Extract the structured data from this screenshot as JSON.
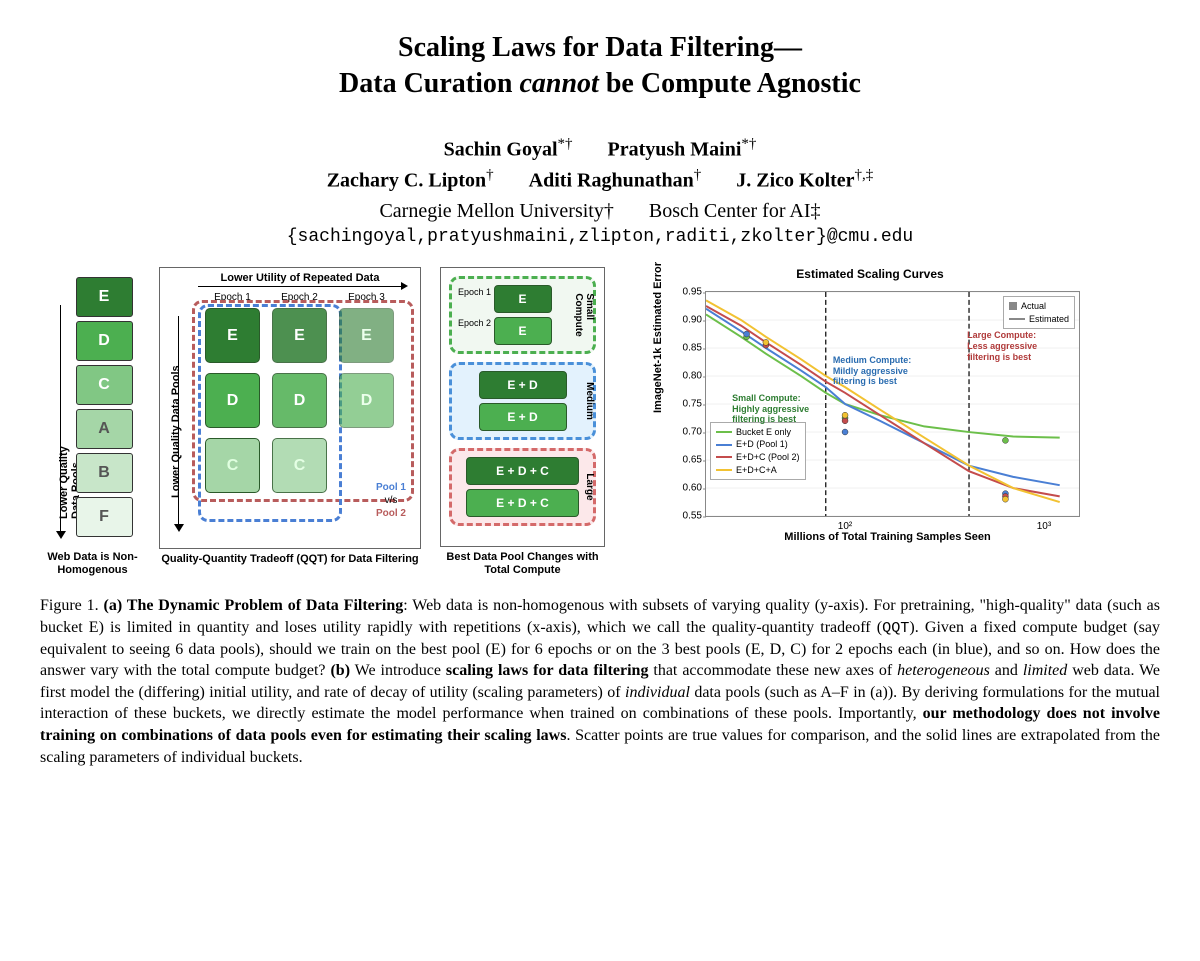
{
  "title_line1": "Scaling Laws for Data Filtering—",
  "title_line2_a": "Data Curation ",
  "title_line2_b": "cannot",
  "title_line2_c": " be Compute Agnostic",
  "authors": {
    "a1": "Sachin Goyal",
    "a1_sup": "*†",
    "a2": "Pratyush Maini",
    "a2_sup": "*†",
    "a3": "Zachary C. Lipton",
    "a3_sup": "†",
    "a4": "Aditi Raghunathan",
    "a4_sup": "†",
    "a5": "J. Zico Kolter",
    "a5_sup": "†,‡"
  },
  "affil1": "Carnegie Mellon University",
  "affil1_sup": "†",
  "affil2": "Bosch Center for AI",
  "affil2_sup": "‡",
  "emails": "{sachingoyal,pratyushmaini,zlipton,raditi,zkolter}@cmu.edu",
  "panel1": {
    "ylabel": "Lower Quality Data Pools",
    "buckets": [
      "E",
      "D",
      "C",
      "A",
      "B",
      "F"
    ],
    "colors": [
      "#2e7d32",
      "#4caf50",
      "#81c784",
      "#a5d6a7",
      "#c8e6c9",
      "#e8f5e9"
    ],
    "caption": "Web Data is Non-Homogenous"
  },
  "panel2": {
    "xlabel": "Lower Utility of Repeated Data",
    "ylabel": "Lower Quality Data Pools",
    "col_heads": [
      "Epoch 1",
      "Epoch 2",
      "Epoch 3"
    ],
    "grid": [
      [
        "E",
        "E",
        "E"
      ],
      [
        "D",
        "D",
        "D"
      ],
      [
        "C",
        "C",
        ""
      ]
    ],
    "colors_row": [
      "#2e7d32",
      "#4caf50",
      "#a5d6a7"
    ],
    "legend": {
      "pool1": "Pool 1",
      "vs": "v/s",
      "pool2": "Pool 2"
    },
    "caption": "Quality-Quantity Tradeoff (QQT) for Data Filtering"
  },
  "panel3": {
    "small": {
      "label": "Small Compute",
      "epochs": [
        "Epoch 1",
        "Epoch 2"
      ],
      "items": [
        "E",
        "E"
      ],
      "color": "#4caf50",
      "border": "#4caf50"
    },
    "medium": {
      "label": "Medium",
      "items": [
        "E + D",
        "E + D"
      ],
      "color": "#4a90d9",
      "border": "#4a90d9",
      "bg": "#e3f2fd"
    },
    "large": {
      "label": "Large",
      "items": [
        "E + D + C",
        "E + D + C"
      ],
      "color": "#d46a6a",
      "border": "#d46a6a",
      "bg": "#fce4ec"
    },
    "caption": "Best Data Pool Changes with Total Compute"
  },
  "panel4": {
    "title": "Estimated Scaling Curves",
    "xlabel": "Millions of Total Training Samples Seen",
    "ylabel": "ImageNet-1k Estimated Error",
    "legend1": {
      "actual": "Actual",
      "estimated": "Estimated"
    },
    "legend2": [
      "Bucket E only",
      "E+D (Pool 1)",
      "E+D+C (Pool 2)",
      "E+D+C+A"
    ],
    "legend2_colors": [
      "#6cbf4a",
      "#4a7fd4",
      "#c44c4c",
      "#f2c232"
    ],
    "annotations": {
      "small": "Small Compute:\nHighly aggressive\nfiltering is best",
      "medium": "Medium Compute:\nMildly aggressive\nfiltering is best",
      "large": "Large Compute:\nLess aggressive\nfiltering is best"
    },
    "annot_colors": {
      "small": "#2e7d32",
      "medium": "#2a6cb0",
      "large": "#b03a3a"
    }
  },
  "caption": {
    "fig": "Figure 1.",
    "a_head": "(a) The Dynamic Problem of Data Filtering",
    "a_body": ": Web data is non-homogenous with subsets of varying quality (y-axis). For pretraining, \"high-quality\" data (such as bucket E) is limited in quantity and loses utility rapidly with repetitions (x-axis), which we call the quality-quantity tradeoff (",
    "qqt": "QQT",
    "a_body2": "). Given a fixed compute budget (say equivalent to seeing 6 data pools), should we train on the best pool (E) for 6 epochs or on the 3 best pools (E, D, C) for 2 epochs each (in blue), and so on. How does the answer vary with the total compute budget? ",
    "b_head": "(b)",
    "b_body": " We introduce ",
    "b_bold": "scaling laws for data filtering",
    "b_body2": " that accommodate these new axes of ",
    "it1": "heterogeneous",
    "b_and": " and ",
    "it2": "limited",
    "b_body3": " web data. We first model the (differing) initial utility, and rate of decay of utility (scaling parameters) of ",
    "it3": "individual",
    "b_body4": " data pools (such as A–F in (a)). By deriving formulations for the mutual interaction of these buckets, we directly estimate the model performance when trained on combinations of these pools. Importantly, ",
    "b_bold2": "our methodology does not involve training on combinations of data pools even for estimating their scaling laws",
    "b_body5": ". Scatter points are true values for comparison, and the solid lines are extrapolated from the scaling parameters of individual buckets."
  },
  "chart_data": {
    "type": "line",
    "title": "Estimated Scaling Curves",
    "xlabel": "Millions of Total Training Samples Seen",
    "ylabel": "ImageNet-1k Estimated Error",
    "xscale": "log",
    "xlim": [
      20,
      1500
    ],
    "ylim": [
      0.55,
      0.95
    ],
    "xticks": [
      100,
      1000
    ],
    "xticklabels": [
      "10²",
      "10³"
    ],
    "yticks": [
      0.55,
      0.6,
      0.65,
      0.7,
      0.75,
      0.8,
      0.85,
      0.9,
      0.95
    ],
    "vlines": [
      80,
      420
    ],
    "series": [
      {
        "name": "Bucket E only",
        "color": "#6cbf4a",
        "marker": "circle",
        "x": [
          20,
          30,
          40,
          60,
          80,
          100,
          150,
          250,
          420,
          700,
          1200
        ],
        "y": [
          0.91,
          0.87,
          0.84,
          0.8,
          0.77,
          0.75,
          0.73,
          0.71,
          0.7,
          0.692,
          0.69
        ]
      },
      {
        "name": "E+D (Pool 1)",
        "color": "#4a7fd4",
        "marker": "star",
        "x": [
          20,
          30,
          40,
          60,
          80,
          100,
          150,
          250,
          420,
          700,
          1200
        ],
        "y": [
          0.92,
          0.88,
          0.85,
          0.81,
          0.78,
          0.75,
          0.72,
          0.68,
          0.64,
          0.62,
          0.605
        ]
      },
      {
        "name": "E+D+C (Pool 2)",
        "color": "#c44c4c",
        "marker": "triangle",
        "x": [
          20,
          30,
          40,
          60,
          80,
          100,
          150,
          250,
          420,
          700,
          1200
        ],
        "y": [
          0.925,
          0.89,
          0.86,
          0.82,
          0.79,
          0.77,
          0.73,
          0.68,
          0.63,
          0.6,
          0.585
        ]
      },
      {
        "name": "E+D+C+A",
        "color": "#f2c232",
        "marker": "square",
        "x": [
          20,
          30,
          40,
          60,
          80,
          100,
          150,
          250,
          420,
          700,
          1200
        ],
        "y": [
          0.935,
          0.9,
          0.87,
          0.83,
          0.8,
          0.78,
          0.74,
          0.69,
          0.64,
          0.6,
          0.575
        ]
      }
    ],
    "actual_points": [
      {
        "series": "Bucket E only",
        "x": 32,
        "y": 0.87
      },
      {
        "series": "Bucket E only",
        "x": 100,
        "y": 0.725
      },
      {
        "series": "Bucket E only",
        "x": 640,
        "y": 0.685
      },
      {
        "series": "E+D",
        "x": 32,
        "y": 0.875
      },
      {
        "series": "E+D",
        "x": 100,
        "y": 0.7
      },
      {
        "series": "E+D",
        "x": 640,
        "y": 0.59
      },
      {
        "series": "E+D+C",
        "x": 40,
        "y": 0.855
      },
      {
        "series": "E+D+C",
        "x": 100,
        "y": 0.72
      },
      {
        "series": "E+D+C",
        "x": 640,
        "y": 0.585
      },
      {
        "series": "E+D+C+A",
        "x": 40,
        "y": 0.86
      },
      {
        "series": "E+D+C+A",
        "x": 100,
        "y": 0.73
      },
      {
        "series": "E+D+C+A",
        "x": 640,
        "y": 0.58
      }
    ],
    "legend_box1": [
      {
        "label": "Actual",
        "type": "marker"
      },
      {
        "label": "Estimated",
        "type": "line"
      }
    ]
  }
}
